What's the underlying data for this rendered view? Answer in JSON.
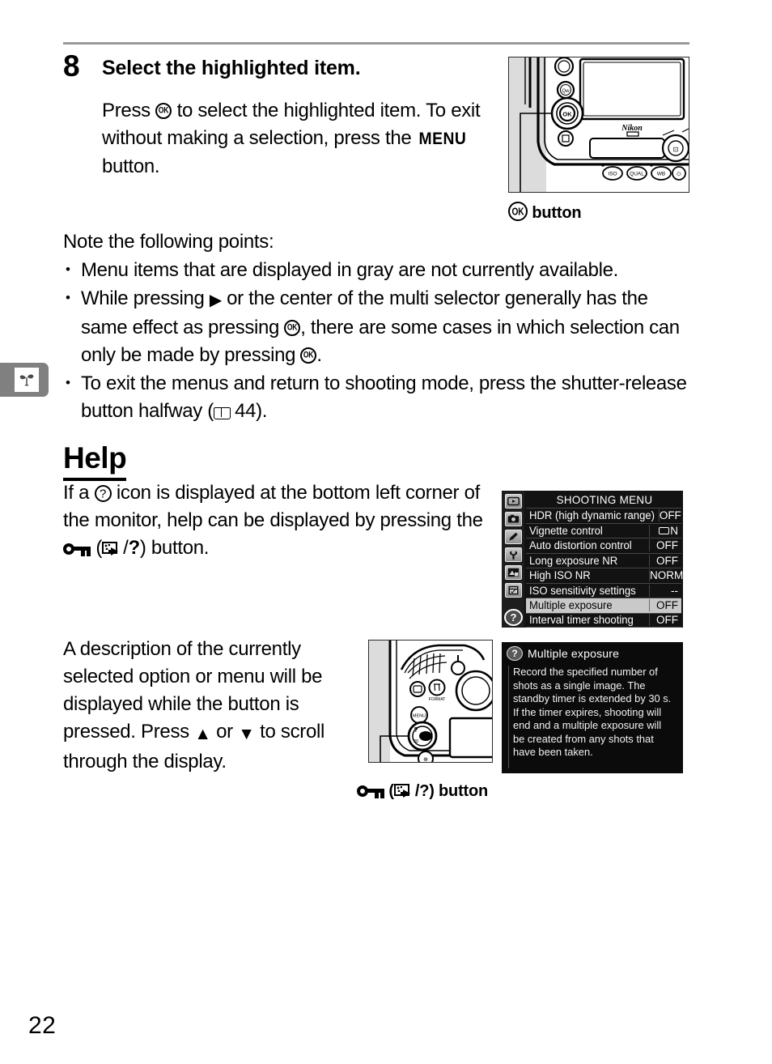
{
  "page": {
    "number": "22"
  },
  "margin_tab": {
    "icon": "flower-plant-icon"
  },
  "step": {
    "number": "8",
    "title": "Select the highlighted item.",
    "body_part1": "Press ",
    "body_part2": " to select the highlighted item.  To exit without making a selection, press the ",
    "menu_label": "MENU",
    "body_part3": " button."
  },
  "note": {
    "lead": "Note the following points:",
    "bullets": [
      {
        "parts": [
          {
            "type": "text",
            "value": "Menu items that are displayed in gray are not currently available."
          }
        ]
      },
      {
        "parts": [
          {
            "type": "text",
            "value": "While pressing "
          },
          {
            "type": "icon",
            "value": "right-triangle-icon"
          },
          {
            "type": "text",
            "value": " or the center of the multi selector generally has the same effect as pressing "
          },
          {
            "type": "icon",
            "value": "ok-button-icon"
          },
          {
            "type": "text",
            "value": ", there are some cases in which selection can only be made by pressing "
          },
          {
            "type": "icon",
            "value": "ok-button-icon"
          },
          {
            "type": "text",
            "value": "."
          }
        ]
      },
      {
        "parts": [
          {
            "type": "text",
            "value": "To exit the menus and return to shooting mode, press the shutter-release button halfway ("
          },
          {
            "type": "icon",
            "value": "book-reference-icon"
          },
          {
            "type": "text",
            "value": " 44)."
          }
        ]
      }
    ],
    "bullet1_text": "Menu items that are displayed in gray are not currently available.",
    "bullet2_a": "While pressing ",
    "bullet2_b": " or the center of the multi selector generally has the same effect as pressing ",
    "bullet2_c": ", there are some cases in which selection can only be made by pressing ",
    "bullet2_d": ".",
    "bullet3_a": "To exit the menus and return to shooting mode, press the shutter-release button halfway (",
    "bullet3_page": " 44)."
  },
  "help_section": {
    "heading": "Help",
    "para_a": "If a ",
    "para_b": " icon is displayed at the bottom left corner of the monitor, help can be displayed by pressing the ",
    "para_c": " (",
    "para_d": "/",
    "para_e": "?",
    "para_f": ") button.",
    "description_a": "A description of the currently selected option or menu will be displayed while the button is pressed.  Press ",
    "description_up": "▲",
    "description_mid": " or ",
    "description_down": "▼",
    "description_b": " to scroll through the display."
  },
  "captions": {
    "ok_button": "button",
    "key_button_mid": " (",
    "key_button_slash": "/",
    "key_button_q": "?",
    "key_button_end": ") button"
  },
  "lcd_menu": {
    "title": "SHOOTING MENU",
    "rail_icons": [
      "playback-menu-icon",
      "shooting-menu-icon",
      "custom-settings-menu-icon",
      "setup-menu-icon",
      "retouch-menu-icon",
      "recent-settings-menu-icon"
    ],
    "help_badge": "?",
    "rows": [
      {
        "label": "HDR (high dynamic range)",
        "value": "OFF",
        "selected": false
      },
      {
        "label": "Vignette control",
        "value": "N",
        "value_icon": "rounded-rect-icon",
        "selected": false
      },
      {
        "label": "Auto distortion control",
        "value": "OFF",
        "selected": false
      },
      {
        "label": "Long exposure NR",
        "value": "OFF",
        "selected": false
      },
      {
        "label": "High ISO NR",
        "value": "NORM",
        "selected": false
      },
      {
        "label": "ISO sensitivity settings",
        "value": "--",
        "selected": false
      },
      {
        "label": "Multiple exposure",
        "value": "OFF",
        "selected": true
      },
      {
        "label": "Interval timer shooting",
        "value": "OFF",
        "selected": false
      }
    ]
  },
  "lcd_help": {
    "badge": "?",
    "title": "Multiple exposure",
    "body": "Record the specified number of shots as a single image. The standby timer is extended by 30 s. If the timer expires, shooting will end and a multiple exposure will be created from any shots that have been taken."
  },
  "colors": {
    "rule": "#9a9a9a",
    "margin_tab": "#808080",
    "lcd_background": "#121212",
    "lcd_selected_row": "#c9c9c9"
  }
}
